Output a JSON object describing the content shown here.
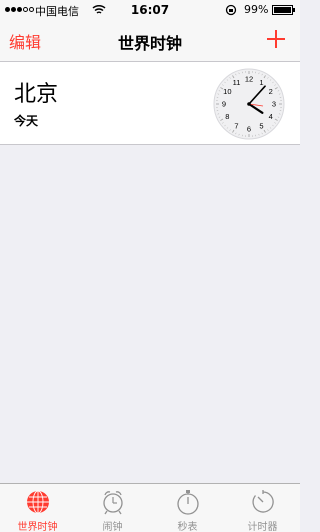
{
  "status_bar": {
    "carrier": "中国电信",
    "time": "16:07",
    "battery_percent": "99%"
  },
  "nav": {
    "edit_label": "编辑",
    "title": "世界时钟",
    "add_icon": "plus-icon"
  },
  "clocks": [
    {
      "city": "北京",
      "day": "今天",
      "time_shown": "16:07",
      "dial_numbers": [
        "12",
        "1",
        "2",
        "3",
        "4",
        "5",
        "6",
        "7",
        "8",
        "9",
        "10",
        "11"
      ]
    }
  ],
  "tab_bar": {
    "tabs": [
      {
        "label": "世界时钟",
        "icon": "globe-icon",
        "active": true
      },
      {
        "label": "闹钟",
        "icon": "alarm-clock-icon",
        "active": false
      },
      {
        "label": "秒表",
        "icon": "stopwatch-icon",
        "active": false
      },
      {
        "label": "计时器",
        "icon": "timer-icon",
        "active": false
      }
    ]
  },
  "colors": {
    "accent": "#ff3b30",
    "inactive_tab": "#929292",
    "background": "#efeff4"
  }
}
